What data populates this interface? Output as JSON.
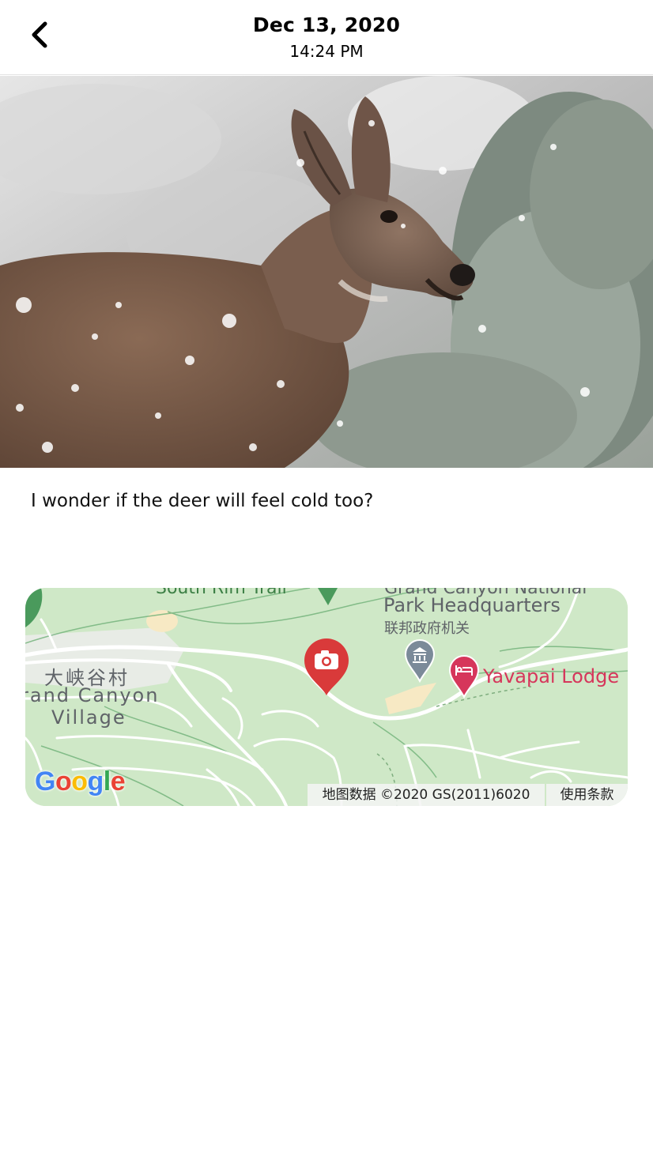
{
  "header": {
    "date": "Dec 13, 2020",
    "time": "14:24 PM"
  },
  "entry": {
    "caption": "I wonder if the deer will feel cold too?"
  },
  "map": {
    "labels": {
      "trail_partial": "South Rim Trail",
      "hq_partial": "Grand Canyon National",
      "hq": "Park Headquarters",
      "hq_category": "联邦政府机关",
      "village_cn": "大峡谷村",
      "village_en_line1": "rand Canyon",
      "village_en_line2": "Village",
      "lodge": "Yavapai Lodge"
    },
    "google_logo": [
      "G",
      "o",
      "o",
      "g",
      "l",
      "e"
    ],
    "attribution": "地图数据 ©2020 GS(2011)6020",
    "terms": "使用条款",
    "colors": {
      "land": "#cfe8c7",
      "road": "#ffffff",
      "camera_pin": "#d93a3a",
      "lodge": "#d6365b",
      "museum_pin": "#7b8a99"
    }
  },
  "icons": {
    "back": "chevron-left-icon",
    "camera_pin": "camera-map-pin-icon",
    "museum_pin": "government-building-pin-icon",
    "lodge_pin": "hotel-bed-pin-icon"
  }
}
